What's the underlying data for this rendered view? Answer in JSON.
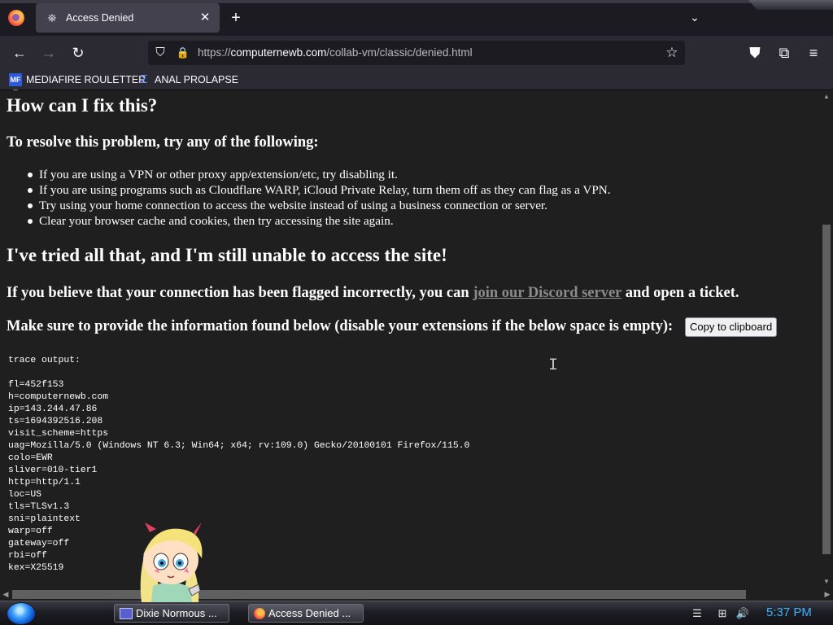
{
  "browser": {
    "tab": {
      "title": "Access Denied"
    },
    "url": {
      "scheme": "https://",
      "host": "computernewb.com",
      "path": "/collab-vm/classic/denied.html"
    },
    "bookmarks": [
      {
        "icon_text": "MF T",
        "label": "MEDIAFIRE ROULETTER"
      },
      {
        "label": "ANAL PROLAPSE"
      }
    ],
    "icons": {
      "back": "←",
      "forward": "→",
      "reload": "↻",
      "shield": "⛉",
      "lock": "🔒",
      "star": "☆",
      "pocket": "⛊",
      "extensions": "⧉",
      "menu": "≡",
      "new_tab": "+",
      "close_tab": "✕",
      "tab_list": "⌄",
      "tab_favicon": "⛯"
    }
  },
  "page": {
    "heading_fix": "How can I fix this?",
    "resolve_heading": "To resolve this problem, try any of the following:",
    "bullets": [
      "If you are using a VPN or other proxy app/extension/etc, try disabling it.",
      "If you are using programs such as Cloudflare WARP, iCloud Private Relay, turn them off as they can flag as a VPN.",
      "Try using your home connection to access the website instead of using a business connection or server.",
      "Clear your browser cache and cookies, then try accessing the site again."
    ],
    "heading_tried": "I've tried all that, and I'm still unable to access the site!",
    "flagged": {
      "before": "If you believe that your connection has been flagged incorrectly, you can ",
      "link": "join our Discord server",
      "after": " and open a ticket."
    },
    "info_text": "Make sure to provide the information found below (disable your extensions if the below space is empty):",
    "copy_button": "Copy to clipboard",
    "trace": "trace output:\n\nfl=452f153\nh=computernewb.com\nip=143.244.47.86\nts=1694392516.208\nvisit_scheme=https\nuag=Mozilla/5.0 (Windows NT 6.3; Win64; x64; rv:109.0) Gecko/20100101 Firefox/115.0\ncolo=EWR\nsliver=010-tier1\nhttp=http/1.1\nloc=US\ntls=TLSv1.3\nsni=plaintext\nwarp=off\ngateway=off\nrbi=off\nkex=X25519"
  },
  "taskbar": {
    "buttons": [
      {
        "label": "Dixie Normous ..."
      },
      {
        "label": "Access Denied ..."
      }
    ],
    "clock": "5:37 PM"
  },
  "colors": {
    "page_bg": "#1f1f1f",
    "link": "#8b8b8b",
    "clock": "#3db5ff",
    "toolbar": "#2b2a33"
  }
}
